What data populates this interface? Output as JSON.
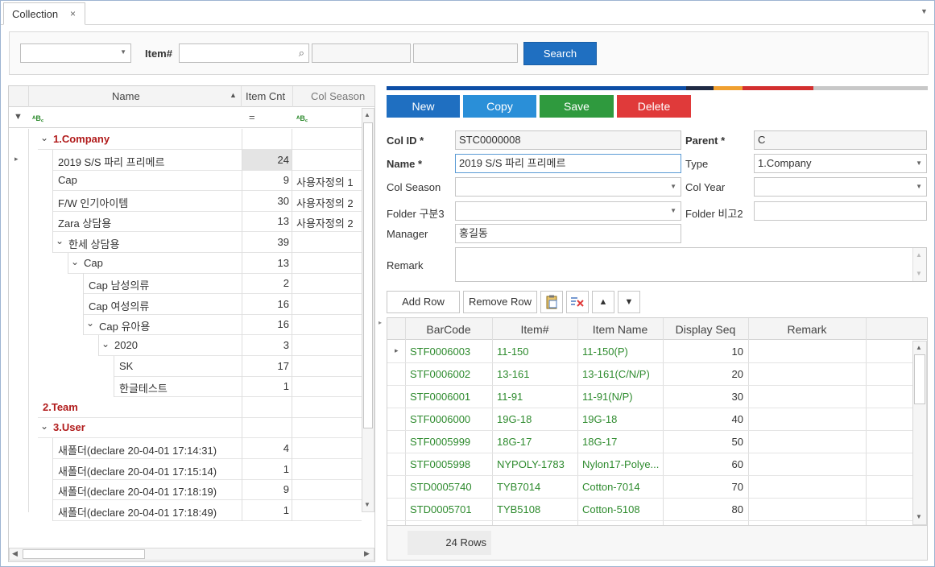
{
  "tab": {
    "title": "Collection",
    "close": "×"
  },
  "search": {
    "item_label": "Item#",
    "button": "Search",
    "combo_value": "",
    "item_value": "",
    "field2": "",
    "field3": ""
  },
  "tree": {
    "columns": [
      "Name",
      "Item Cnt",
      "Col Season"
    ],
    "filter_eq": "=",
    "rows": [
      {
        "name": "1.Company",
        "cnt": "",
        "season": "",
        "level": 0,
        "expand": "open",
        "group": true
      },
      {
        "name": "2019 S/S 파리 프리메르",
        "cnt": "24",
        "season": "",
        "level": 1,
        "expand": "",
        "group": false,
        "selected": true
      },
      {
        "name": "Cap",
        "cnt": "9",
        "season": "사용자정의 1",
        "level": 1,
        "expand": "",
        "group": false
      },
      {
        "name": "F/W 인기아이템",
        "cnt": "30",
        "season": "사용자정의 2",
        "level": 1,
        "expand": "",
        "group": false
      },
      {
        "name": "Zara 상담용",
        "cnt": "13",
        "season": "사용자정의 2",
        "level": 1,
        "expand": "",
        "group": false
      },
      {
        "name": "한세 상담용",
        "cnt": "39",
        "season": "",
        "level": 1,
        "expand": "open",
        "group": false
      },
      {
        "name": "Cap",
        "cnt": "13",
        "season": "",
        "level": 2,
        "expand": "open",
        "group": false
      },
      {
        "name": "Cap 남성의류",
        "cnt": "2",
        "season": "",
        "level": 3,
        "expand": "",
        "group": false
      },
      {
        "name": "Cap 여성의류",
        "cnt": "16",
        "season": "",
        "level": 3,
        "expand": "",
        "group": false
      },
      {
        "name": "Cap 유아용",
        "cnt": "16",
        "season": "",
        "level": 3,
        "expand": "open",
        "group": false
      },
      {
        "name": "2020",
        "cnt": "3",
        "season": "",
        "level": 4,
        "expand": "open",
        "group": false
      },
      {
        "name": "SK",
        "cnt": "17",
        "season": "",
        "level": 5,
        "expand": "",
        "group": false
      },
      {
        "name": "한글테스트",
        "cnt": "1",
        "season": "",
        "level": 5,
        "expand": "",
        "group": false
      },
      {
        "name": "2.Team",
        "cnt": "",
        "season": "",
        "level": 0,
        "expand": "",
        "group": true
      },
      {
        "name": "3.User",
        "cnt": "",
        "season": "",
        "level": 0,
        "expand": "open",
        "group": true
      },
      {
        "name": "새폴더(declare 20-04-01 17:14:31)",
        "cnt": "4",
        "season": "",
        "level": 1,
        "expand": "",
        "group": false
      },
      {
        "name": "새폴더(declare 20-04-01 17:15:14)",
        "cnt": "1",
        "season": "",
        "level": 1,
        "expand": "",
        "group": false
      },
      {
        "name": "새폴더(declare 20-04-01 17:18:19)",
        "cnt": "9",
        "season": "",
        "level": 1,
        "expand": "",
        "group": false
      },
      {
        "name": "새폴더(declare 20-04-01 17:18:49)",
        "cnt": "1",
        "season": "",
        "level": 1,
        "expand": "",
        "group": false
      }
    ]
  },
  "actions": {
    "new": "New",
    "copy": "Copy",
    "save": "Save",
    "delete": "Delete"
  },
  "form": {
    "col_id_label": "Col ID *",
    "col_id": "STC0000008",
    "parent_label": "Parent *",
    "parent": "C",
    "name_label": "Name *",
    "name": "2019 S/S 파리 프리메르",
    "type_label": "Type",
    "type": "1.Company",
    "season_label": "Col Season",
    "season": "",
    "year_label": "Col Year",
    "year": "",
    "folder_label": "Folder 구분3",
    "folder": "",
    "folder_note_label": "Folder 비고2",
    "folder_note": "",
    "manager_label": "Manager",
    "manager": "홍길동",
    "remark_label": "Remark",
    "remark": ""
  },
  "detail_toolbar": {
    "add_row": "Add Row",
    "remove_row": "Remove Row"
  },
  "detail": {
    "columns": [
      "BarCode",
      "Item#",
      "Item Name",
      "Display Seq",
      "Remark"
    ],
    "rows": [
      {
        "barcode": "STF0006003",
        "item": "11-150",
        "name": "11-150(P)",
        "seq": "10",
        "remark": ""
      },
      {
        "barcode": "STF0006002",
        "item": "13-161",
        "name": "13-161(C/N/P)",
        "seq": "20",
        "remark": ""
      },
      {
        "barcode": "STF0006001",
        "item": "11-91",
        "name": "11-91(N/P)",
        "seq": "30",
        "remark": ""
      },
      {
        "barcode": "STF0006000",
        "item": "19G-18",
        "name": "19G-18",
        "seq": "40",
        "remark": ""
      },
      {
        "barcode": "STF0005999",
        "item": "18G-17",
        "name": "18G-17",
        "seq": "50",
        "remark": ""
      },
      {
        "barcode": "STF0005998",
        "item": "NYPOLY-1783",
        "name": "Nylon17-Polye...",
        "seq": "60",
        "remark": ""
      },
      {
        "barcode": "STD0005740",
        "item": "TYB7014",
        "name": "Cotton-7014",
        "seq": "70",
        "remark": ""
      },
      {
        "barcode": "STD0005701",
        "item": "TYB5108",
        "name": "Cotton-5108",
        "seq": "80",
        "remark": ""
      }
    ],
    "footer": "24 Rows"
  },
  "colors": {
    "new": "#1f6fc1",
    "copy": "#2a8fd8",
    "save": "#2f9a3e",
    "delete": "#e03a3a",
    "search": "#1f6fc1"
  }
}
